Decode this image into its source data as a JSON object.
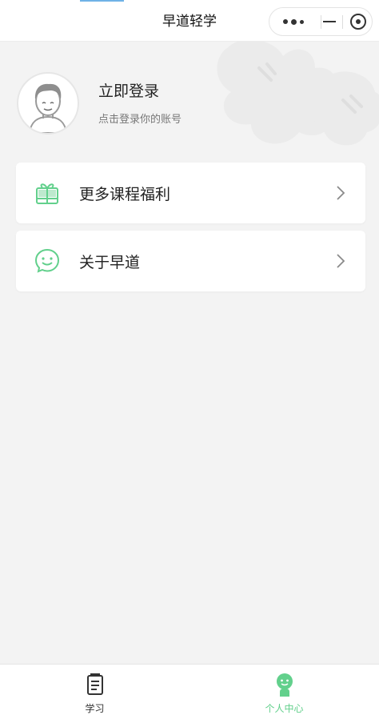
{
  "navbar": {
    "title": "早道轻学",
    "more_icon": "more-dots-icon",
    "minimize_icon": "minimize-icon",
    "close_icon": "target-close-icon"
  },
  "profile": {
    "avatar_icon": "user-avatar-icon",
    "title": "立即登录",
    "subtitle": "点击登录你的账号"
  },
  "menu": {
    "items": [
      {
        "label": "更多课程福利",
        "icon": "gift-icon"
      },
      {
        "label": "关于早道",
        "icon": "smile-chat-icon"
      }
    ],
    "chevron_icon": "chevron-right-icon"
  },
  "tabbar": {
    "tabs": [
      {
        "label": "学习",
        "icon": "document-icon",
        "active": false
      },
      {
        "label": "个人中心",
        "icon": "person-icon",
        "active": true
      }
    ]
  },
  "colors": {
    "accent_green": "#62d08c",
    "background": "#f3f3f3",
    "card": "#ffffff"
  }
}
